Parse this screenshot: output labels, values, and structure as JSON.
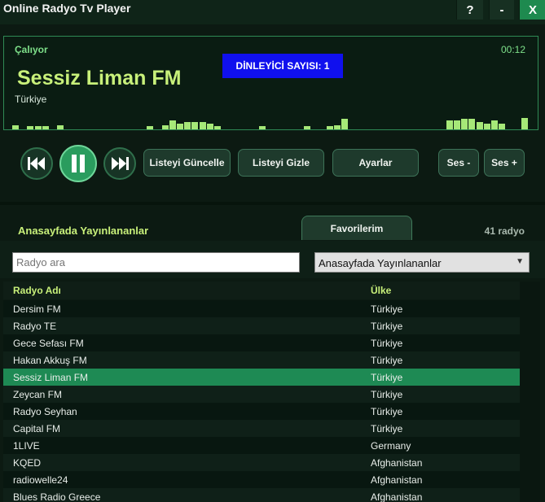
{
  "window": {
    "title": "Online Radyo Tv Player",
    "help": "?",
    "minimize": "-",
    "close": "X"
  },
  "player": {
    "status": "Çalıyor",
    "elapsed": "00:12",
    "listeners": "DİNLEYİCİ SAYISI: 1",
    "station": "Sessiz Liman FM",
    "country": "Türkiye"
  },
  "controls": {
    "prev_icon": "skip-back-icon",
    "pause_icon": "pause-icon",
    "next_icon": "skip-forward-icon",
    "refresh": "Listeyi Güncelle",
    "hide": "Listeyi Gizle",
    "settings": "Ayarlar",
    "vol_down": "Ses -",
    "vol_up": "Ses +"
  },
  "list": {
    "title": "Anasayfada Yayınlananlar",
    "favorites_tab": "Favorilerim",
    "count": "41 radyo",
    "search_placeholder": "Radyo ara",
    "filter_selected": "Anasayfada Yayınlananlar",
    "columns": [
      "Radyo Adı",
      "Ülke"
    ],
    "rows": [
      [
        "Dersim FM",
        "Türkiye"
      ],
      [
        "Radyo TE",
        "Türkiye"
      ],
      [
        "Gece Sefası FM",
        "Türkiye"
      ],
      [
        "Hakan Akkuş FM",
        "Türkiye"
      ],
      [
        "Sessiz Liman FM",
        "Türkiye"
      ],
      [
        "Zeycan FM",
        "Türkiye"
      ],
      [
        "Radyo Seyhan",
        "Türkiye"
      ],
      [
        "Capital FM",
        "Türkiye"
      ],
      [
        "1LIVE",
        "Germany"
      ],
      [
        "KQED",
        "Afghanistan"
      ],
      [
        "radiowelle24",
        "Afghanistan"
      ],
      [
        "Blues Radio Greece",
        "Afghanistan"
      ]
    ],
    "selected_index": 4
  },
  "visualizer_levels": [
    0.3,
    0,
    0.2,
    0.2,
    0.2,
    0,
    0.3,
    0,
    0,
    0,
    0,
    0,
    0,
    0,
    0,
    0,
    0,
    0,
    0.2,
    0,
    0.3,
    0.6,
    0.4,
    0.5,
    0.5,
    0.5,
    0.4,
    0.2,
    0,
    0,
    0,
    0,
    0,
    0.2,
    0,
    0,
    0,
    0,
    0,
    0.2,
    0,
    0,
    0.2,
    0.3,
    0.7,
    0,
    0,
    0,
    0,
    0,
    0,
    0,
    0,
    0,
    0,
    0,
    0,
    0,
    0.6,
    0.6,
    0.7,
    0.7,
    0.5,
    0.4,
    0.6,
    0.4,
    0,
    0,
    0.8,
    0
  ],
  "colors": {
    "accent": "#2a9c5e",
    "highlight_text": "#c8f07a",
    "selected_row": "#1e8a54",
    "listeners_bg": "#1010ee"
  }
}
